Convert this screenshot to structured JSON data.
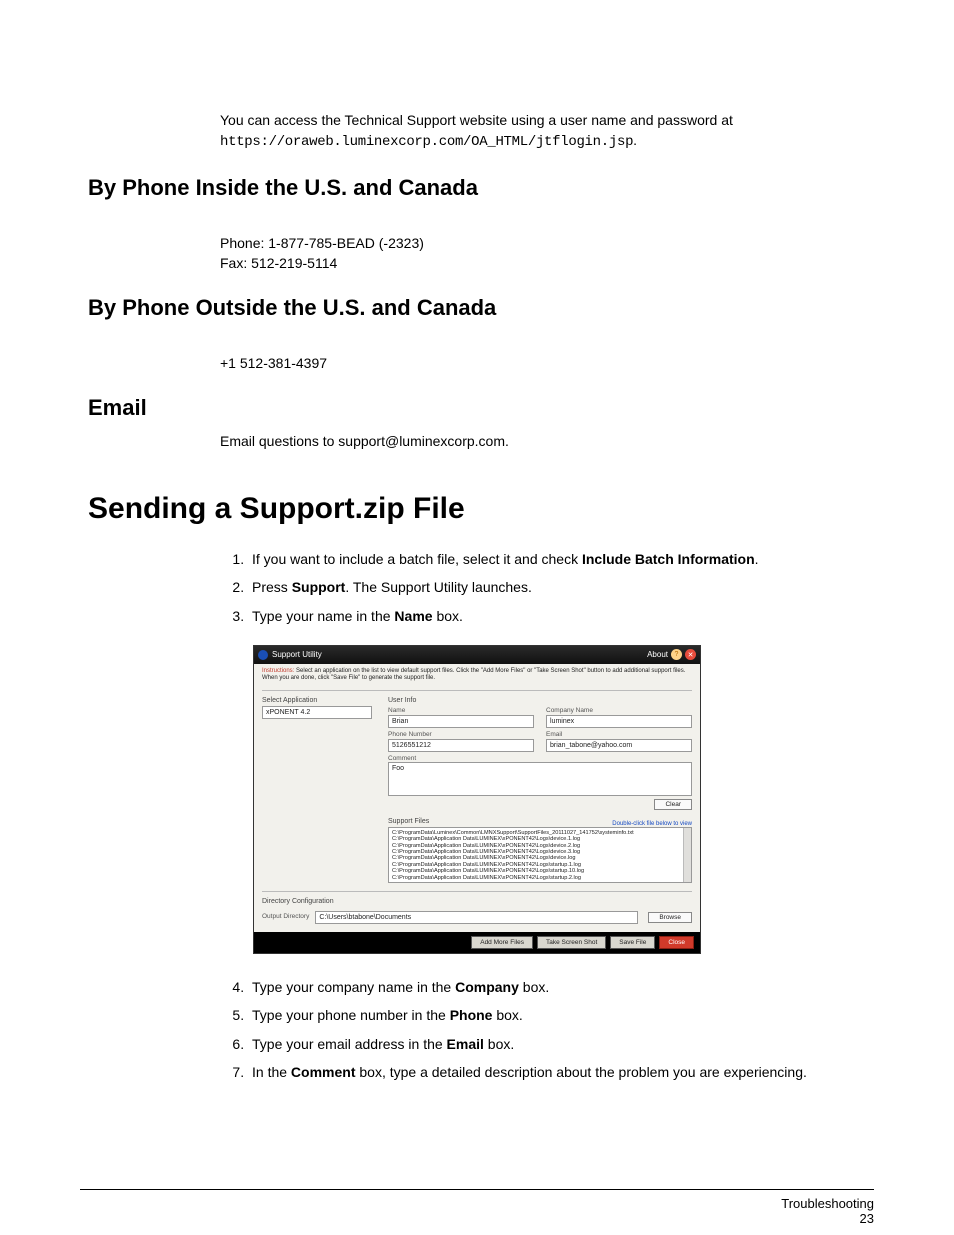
{
  "intro": {
    "line1": "You can access the Technical Support website using a user name and password at",
    "url": "https://oraweb.luminexcorp.com/OA_HTML/jtflogin.jsp",
    "dot": "."
  },
  "headings": {
    "phone_us": "By Phone Inside the U.S. and Canada",
    "phone_intl": "By Phone Outside the U.S. and Canada",
    "email": "Email",
    "sending": "Sending a Support.zip File"
  },
  "phone_us": {
    "phone": "Phone: 1-877-785-BEAD (-2323)",
    "fax": "Fax: 512-219-5114"
  },
  "phone_intl": "+1 512-381-4397",
  "email_text": "Email questions to support@luminexcorp.com.",
  "steps": {
    "s1a": "If you want to include a batch file, select it and check ",
    "s1b": "Include Batch Information",
    "s1c": ".",
    "s2a": "Press ",
    "s2b": "Support",
    "s2c": ". The Support Utility launches.",
    "s3a": "Type your name in the ",
    "s3b": "Name",
    "s3c": " box.",
    "s4a": "Type your company name in the ",
    "s4b": "Company",
    "s4c": " box.",
    "s5a": "Type your phone number in the ",
    "s5b": "Phone",
    "s5c": " box.",
    "s6a": "Type your email address in the ",
    "s6b": "Email",
    "s6c": " box.",
    "s7a": "In the ",
    "s7b": "Comment",
    "s7c": " box, type a detailed description about the problem you are experiencing."
  },
  "app": {
    "title": "Support Utility",
    "about": "About",
    "instr_label": "Instructions:",
    "instr_text": "Select an application on the list to view default support files. Click the \"Add More Files\" or \"Take Screen Shot\" button to add additional support files. When you are done, click \"Save File\" to generate the support file.",
    "select_app": "Select Application",
    "app_value": "xPONENT 4.2",
    "user_info": "User Info",
    "labels": {
      "name": "Name",
      "company": "Company Name",
      "phone": "Phone Number",
      "email": "Email",
      "comment": "Comment"
    },
    "values": {
      "name": "Brian",
      "company": "luminex",
      "phone": "5126551212",
      "email": "brian_tabone@yahoo.com",
      "comment": "Foo"
    },
    "clear": "Clear",
    "support_files": "Support Files",
    "sf_hint": "Double-click file below to view",
    "files": [
      "C:\\ProgramData\\Luminex\\Common\\LMNXSupport\\SupportFiles_20111027_141752\\systeminfo.txt",
      "C:\\ProgramData\\Application Data\\LUMINEX\\xPONENT42\\Logs\\device.1.log",
      "C:\\ProgramData\\Application Data\\LUMINEX\\xPONENT42\\Logs\\device.2.log",
      "C:\\ProgramData\\Application Data\\LUMINEX\\xPONENT42\\Logs\\device.3.log",
      "C:\\ProgramData\\Application Data\\LUMINEX\\xPONENT42\\Logs\\device.log",
      "C:\\ProgramData\\Application Data\\LUMINEX\\xPONENT42\\Logs\\startup.1.log",
      "C:\\ProgramData\\Application Data\\LUMINEX\\xPONENT42\\Logs\\startup.10.log",
      "C:\\ProgramData\\Application Data\\LUMINEX\\xPONENT42\\Logs\\startup.2.log"
    ],
    "dir_config": "Directory Configuration",
    "output_dir_label": "Output Directory",
    "output_dir_value": "C:\\Users\\btabone\\Documents",
    "browse": "Browse",
    "add_files": "Add More Files",
    "screenshot": "Take Screen Shot",
    "save_file": "Save File",
    "close": "Close"
  },
  "footer": {
    "section": "Troubleshooting",
    "page": "23"
  }
}
